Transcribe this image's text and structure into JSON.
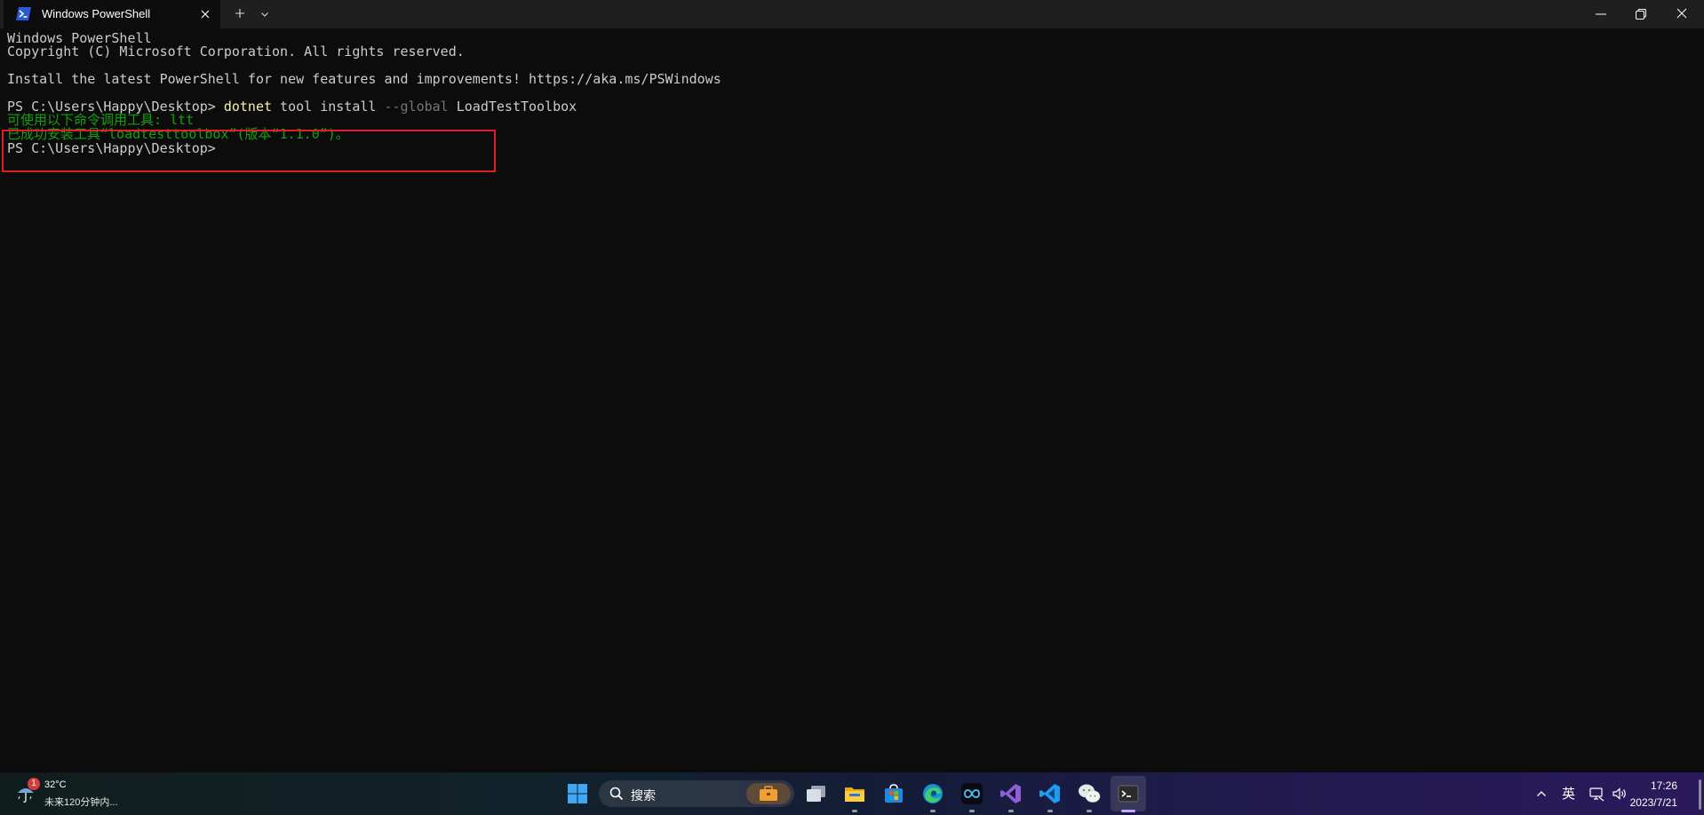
{
  "titlebar": {
    "tab_title": "Windows PowerShell",
    "new_tab_icon": "plus-icon",
    "dropdown_icon": "chevron-down-icon",
    "minimize_icon": "minimize-icon",
    "maximize_icon": "restore-icon",
    "close_icon": "close-icon"
  },
  "terminal": {
    "header_line1": "Windows PowerShell",
    "header_line2": "Copyright (C) Microsoft Corporation. All rights reserved.",
    "header_line4": "Install the latest PowerShell for new features and improvements! https://aka.ms/PSWindows",
    "prompt": "PS C:\\Users\\Happy\\Desktop> ",
    "cmd_name": "dotnet",
    "cmd_args1": " tool install ",
    "cmd_flag": "--global",
    "cmd_args2": " LoadTestToolbox",
    "output_line1": "可使用以下命令调用工具: ltt",
    "output_line2": "已成功安装工具“loadtesttoolbox”(版本“1.1.0”)。",
    "prompt2": "PS C:\\Users\\Happy\\Desktop>",
    "colors": {
      "background": "#0c0c0c",
      "text": "#cccccc",
      "output_green": "#13a10e",
      "command_yellow": "#f9f1a5",
      "flag_gray": "#767676",
      "highlight_red": "#e02020"
    }
  },
  "taskbar": {
    "weather": {
      "badge": "1",
      "temp": "32°C",
      "desc": "未来120分钟内..."
    },
    "search_label": "搜索",
    "apps": [
      "windows-start-icon",
      "task-view-icon",
      "file-explorer-icon",
      "microsoft-store-icon",
      "edge-icon",
      "app-icon",
      "visual-studio-icon",
      "vscode-icon",
      "wechat-icon",
      "terminal-icon"
    ],
    "tray": {
      "ime": "英",
      "time": "17:26",
      "date": "2023/7/21"
    }
  }
}
